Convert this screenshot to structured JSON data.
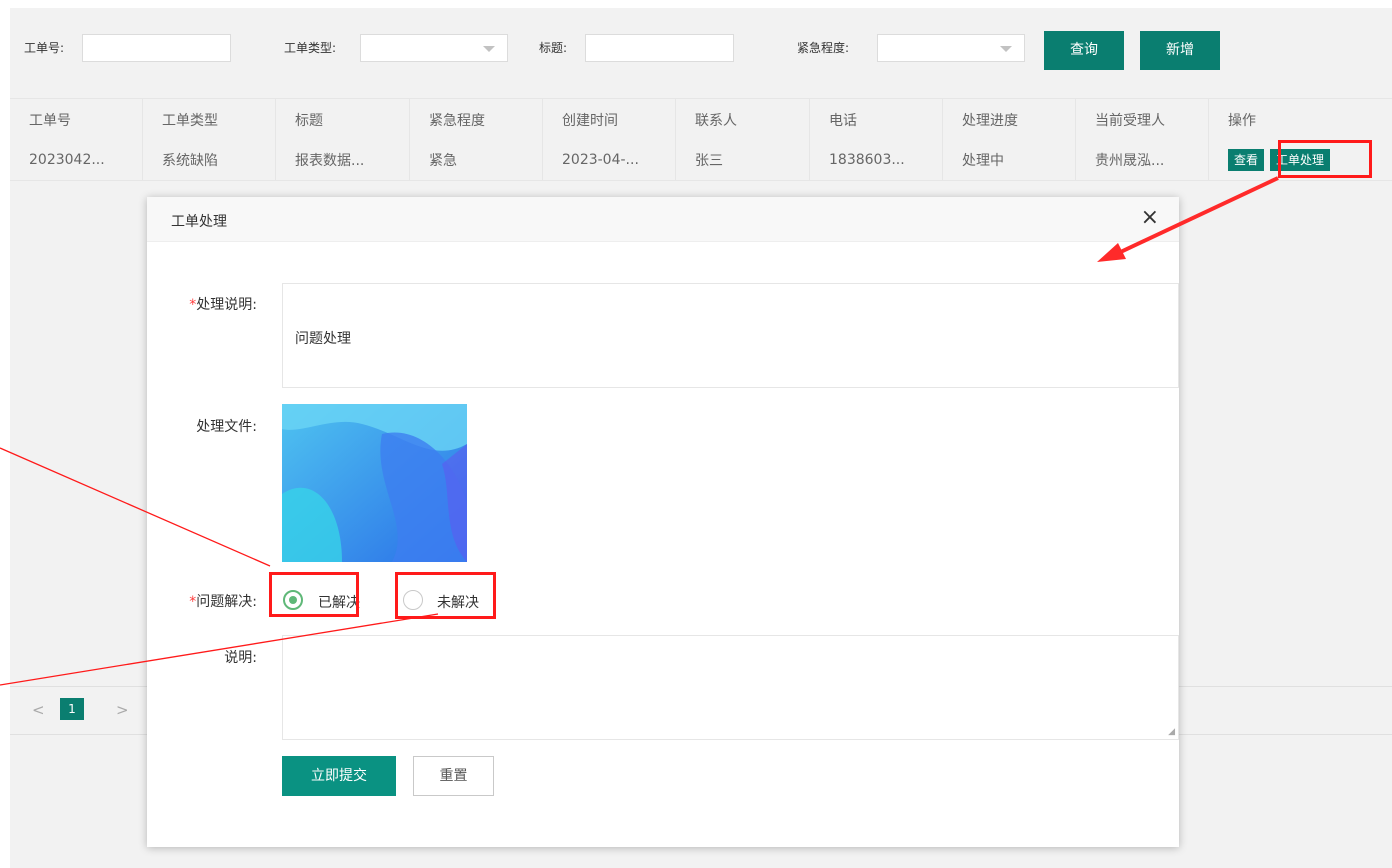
{
  "search": {
    "order_no_label": "工单号:",
    "order_type_label": "工单类型:",
    "title_label": "标题:",
    "urgency_label": "紧急程度:",
    "query_button": "查询",
    "add_button": "新增"
  },
  "table": {
    "headers": [
      "工单号",
      "工单类型",
      "标题",
      "紧急程度",
      "创建时间",
      "联系人",
      "电话",
      "处理进度",
      "当前受理人",
      "操作"
    ],
    "rows": [
      {
        "order_no": "2023042...",
        "type": "系统缺陷",
        "title": "报表数据...",
        "urgency": "紧急",
        "created": "2023-04-...",
        "contact": "张三",
        "phone": "1838603...",
        "progress": "处理中",
        "assignee": "贵州晟泓...",
        "view_button": "查看",
        "process_button": "工单处理"
      }
    ]
  },
  "pager": {
    "prev": "<",
    "current_page": "1",
    "next": ">"
  },
  "dialog": {
    "title": "工单处理",
    "close": "×",
    "required_mark": "*",
    "desc_label": "处理说明:",
    "desc_value": "问题处理",
    "file_label": "处理文件:",
    "resolved_label": "问题解决:",
    "option_resolved": "已解决",
    "option_unresolved": "未解决",
    "selected_option": "已解决",
    "note_label": "说明:",
    "note_value": "",
    "submit_button": "立即提交",
    "reset_button": "重置"
  },
  "colors": {
    "primary": "#0a7e70",
    "annotation": "#ff1a1a",
    "background": "#f2f2f2"
  }
}
